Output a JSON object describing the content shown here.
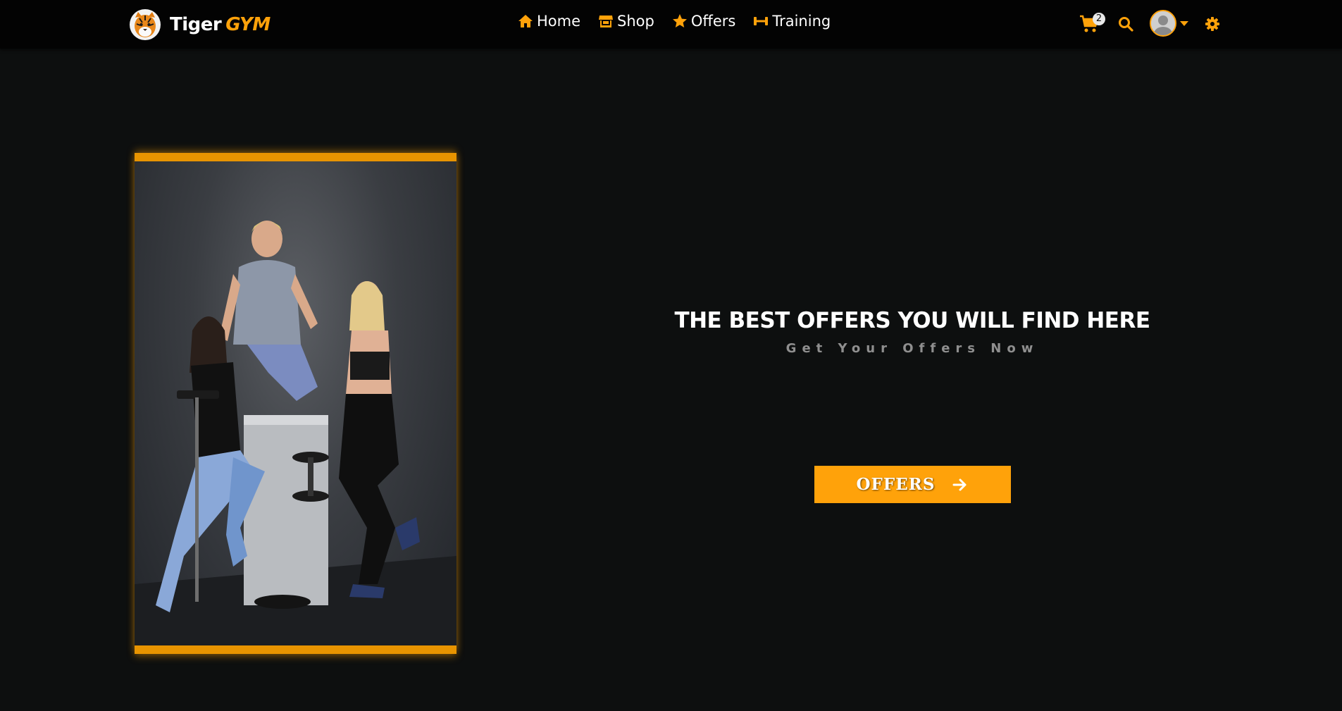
{
  "brand": {
    "name_part1": "Tiger",
    "name_part2": "GYM"
  },
  "nav": {
    "items": [
      {
        "label": "Home",
        "icon": "home-icon"
      },
      {
        "label": "Shop",
        "icon": "store-icon"
      },
      {
        "label": "Offers",
        "icon": "star-icon"
      },
      {
        "label": "Training",
        "icon": "dumbbell-icon"
      }
    ]
  },
  "header_actions": {
    "cart_count": "2",
    "cart_icon": "cart-icon",
    "search_icon": "search-icon",
    "avatar_icon": "user-avatar-icon",
    "dropdown_icon": "caret-down-icon",
    "settings_icon": "gear-icon"
  },
  "hero": {
    "title": "THE BEST OFFERS YOU WILL FIND HERE",
    "subtitle": "Get Your Offers Now",
    "button_label": "OFFERS",
    "button_icon": "arrow-right-icon",
    "image": "gym-group-photo"
  },
  "colors": {
    "accent": "#ffa20a",
    "background": "#0d0f0f",
    "navbar": "#030303",
    "subtitle": "#8f8f8f"
  }
}
